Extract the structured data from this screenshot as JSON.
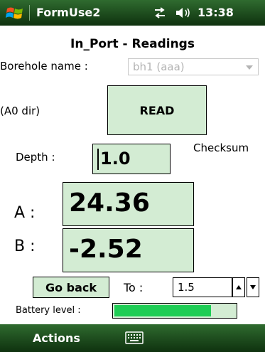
{
  "titlebar": {
    "app_name": "FormUse2",
    "time": "13:38",
    "icons": [
      "windows-start-icon",
      "connectivity-icon",
      "volume-icon"
    ]
  },
  "page": {
    "title": "In_Port - Readings"
  },
  "borehole": {
    "label": "Borehole name :",
    "selected": "bh1   (aaa)"
  },
  "direction_label": "(A0 dir)",
  "read_button": "READ",
  "depth": {
    "label": "Depth :",
    "value": "1.0"
  },
  "checksum_label": "Checksum",
  "reading_a": {
    "label": "A :",
    "value": "24.36"
  },
  "reading_b": {
    "label": "B :",
    "value": "-2.52"
  },
  "go_back_button": "Go back",
  "to": {
    "label": "To :",
    "value": "1.5"
  },
  "battery": {
    "label": "Battery level :",
    "level": 0.8
  },
  "softkeys": {
    "left": "Actions",
    "center_icon": "keyboard-icon"
  },
  "colors": {
    "bar_green": "#1d4b1d",
    "field_green": "#d3ecd3",
    "battery_green": "#1fcd55"
  }
}
